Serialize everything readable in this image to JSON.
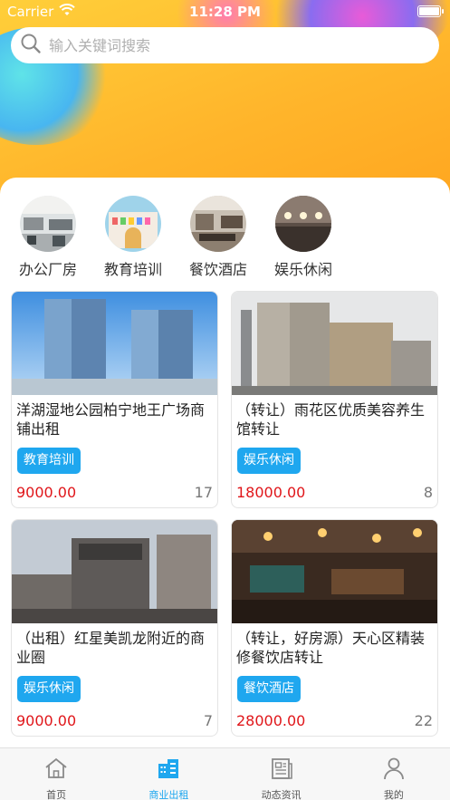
{
  "status_bar": {
    "carrier": "Carrier",
    "time": "11:28 PM"
  },
  "search": {
    "placeholder": "输入关键词搜索"
  },
  "categories": [
    {
      "label": "办公厂房",
      "icon": "office-photo"
    },
    {
      "label": "教育培训",
      "icon": "education-photo"
    },
    {
      "label": "餐饮酒店",
      "icon": "restaurant-photo"
    },
    {
      "label": "娱乐休闲",
      "icon": "leisure-photo"
    }
  ],
  "listings": [
    {
      "title": "洋湖湿地公园柏宁地王广场商铺出租",
      "tag": "教育培训",
      "price": "9000.00",
      "count": "17",
      "image": "glass-towers-photo"
    },
    {
      "title": "（转让）雨花区优质美容养生馆转让",
      "tag": "娱乐休闲",
      "price": "18000.00",
      "count": "8",
      "image": "city-buildings-photo"
    },
    {
      "title": "（出租）红星美凯龙附近的商业圈",
      "tag": "娱乐休闲",
      "price": "9000.00",
      "count": "7",
      "image": "street-mall-photo"
    },
    {
      "title": "（转让，好房源）天心区精装修餐饮店转让",
      "tag": "餐饮酒店",
      "price": "28000.00",
      "count": "22",
      "image": "restaurant-interior-photo"
    }
  ],
  "tabs": [
    {
      "label": "首页",
      "icon": "home-icon",
      "active": false
    },
    {
      "label": "商业出租",
      "icon": "buildings-icon",
      "active": true
    },
    {
      "label": "动态资讯",
      "icon": "news-icon",
      "active": false
    },
    {
      "label": "我的",
      "icon": "user-icon",
      "active": false
    }
  ],
  "colors": {
    "accent": "#1fa7ef",
    "price": "#e0161a",
    "hero": "#ffb52b"
  }
}
